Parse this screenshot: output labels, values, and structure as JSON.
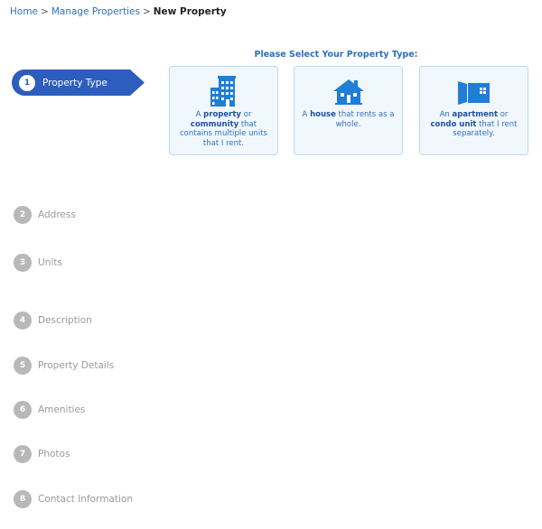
{
  "breadcrumb": {
    "home": "Home",
    "manage": "Manage Properties",
    "separator": ">",
    "current": "New Property"
  },
  "heading": "Please Select Your Property Type:",
  "cards": [
    {
      "pre": "A ",
      "b1": "property",
      "mid": " or ",
      "b2": "community",
      "post": " that contains multiple units that I rent."
    },
    {
      "pre": "A ",
      "b1": "house",
      "mid": "",
      "b2": "",
      "post": " that rents as a whole."
    },
    {
      "pre": "An ",
      "b1": "apartment",
      "mid": " or ",
      "b2": "condo unit",
      "post": " that I rent separately."
    }
  ],
  "steps": [
    {
      "num": "1",
      "label": "Property Type"
    },
    {
      "num": "2",
      "label": "Address"
    },
    {
      "num": "3",
      "label": "Units"
    },
    {
      "num": "4",
      "label": "Description"
    },
    {
      "num": "5",
      "label": "Property Details"
    },
    {
      "num": "6",
      "label": "Amenities"
    },
    {
      "num": "7",
      "label": "Photos"
    },
    {
      "num": "8",
      "label": "Contact Information"
    }
  ],
  "colors": {
    "accent": "#2f6fbf",
    "active_step": "#2c5dbf",
    "card_bg": "#f1f8fd",
    "card_border": "#b9daf0",
    "icon": "#1f7ed6",
    "step_inactive": "#b8b8b8"
  }
}
